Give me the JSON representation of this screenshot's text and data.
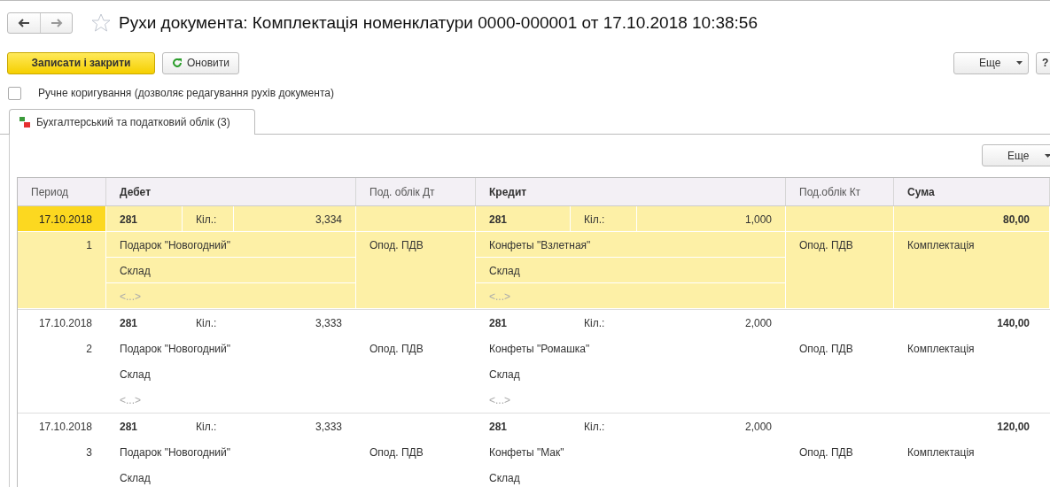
{
  "window": {
    "title": "Рухи документа: Комплектація номенклатури 0000-000001 от 17.10.2018 10:38:56",
    "favorite": false
  },
  "toolbar": {
    "primary": "Записати і закрити",
    "refresh": "Оновити",
    "more": "Еще",
    "help": "?"
  },
  "manual_edit": {
    "label": "Ручне коригування (дозволяє редагування рухів документа)",
    "checked": false
  },
  "tabs": [
    {
      "label": "Бухгалтерський та податковий облік (3)",
      "selected": true
    }
  ],
  "table_toolbar": {
    "more": "Еще"
  },
  "table": {
    "columns": [
      "Период",
      "Дебет",
      "Под. облік Дт",
      "Кредит",
      "Под.облік Кт",
      "Сума"
    ],
    "rows": [
      {
        "selected": true,
        "period": "17.10.2018",
        "number": "1",
        "debit": {
          "account": "281",
          "qty_label": "Кіл.:",
          "qty": "3,334",
          "sub1": "Подарок \"Новогодний\"",
          "sub2": "Склад",
          "sub3": "<...>"
        },
        "subconto_dt": "Опод. ПДВ",
        "credit": {
          "account": "281",
          "qty_label": "Кіл.:",
          "qty": "1,000",
          "sub1": "Конфеты \"Взлетная\"",
          "sub2": "Склад",
          "sub3": "<...>"
        },
        "subconto_kt": "Опод. ПДВ",
        "amount": "80,00",
        "content": "Комплектація"
      },
      {
        "selected": false,
        "period": "17.10.2018",
        "number": "2",
        "debit": {
          "account": "281",
          "qty_label": "Кіл.:",
          "qty": "3,333",
          "sub1": "Подарок \"Новогодний\"",
          "sub2": "Склад",
          "sub3": "<...>"
        },
        "subconto_dt": "Опод. ПДВ",
        "credit": {
          "account": "281",
          "qty_label": "Кіл.:",
          "qty": "2,000",
          "sub1": "Конфеты \"Ромашка\"",
          "sub2": "Склад",
          "sub3": "<...>"
        },
        "subconto_kt": "Опод. ПДВ",
        "amount": "140,00",
        "content": "Комплектація"
      },
      {
        "selected": false,
        "period": "17.10.2018",
        "number": "3",
        "debit": {
          "account": "281",
          "qty_label": "Кіл.:",
          "qty": "3,333",
          "sub1": "Подарок \"Новогодний\"",
          "sub2": "Склад"
        },
        "subconto_dt": "Опод. ПДВ",
        "credit": {
          "account": "281",
          "qty_label": "Кіл.:",
          "qty": "2,000",
          "sub1": "Конфеты \"Мак\"",
          "sub2": "Склад"
        },
        "subconto_kt": "Опод. ПДВ",
        "amount": "120,00",
        "content": "Комплектація"
      }
    ]
  }
}
